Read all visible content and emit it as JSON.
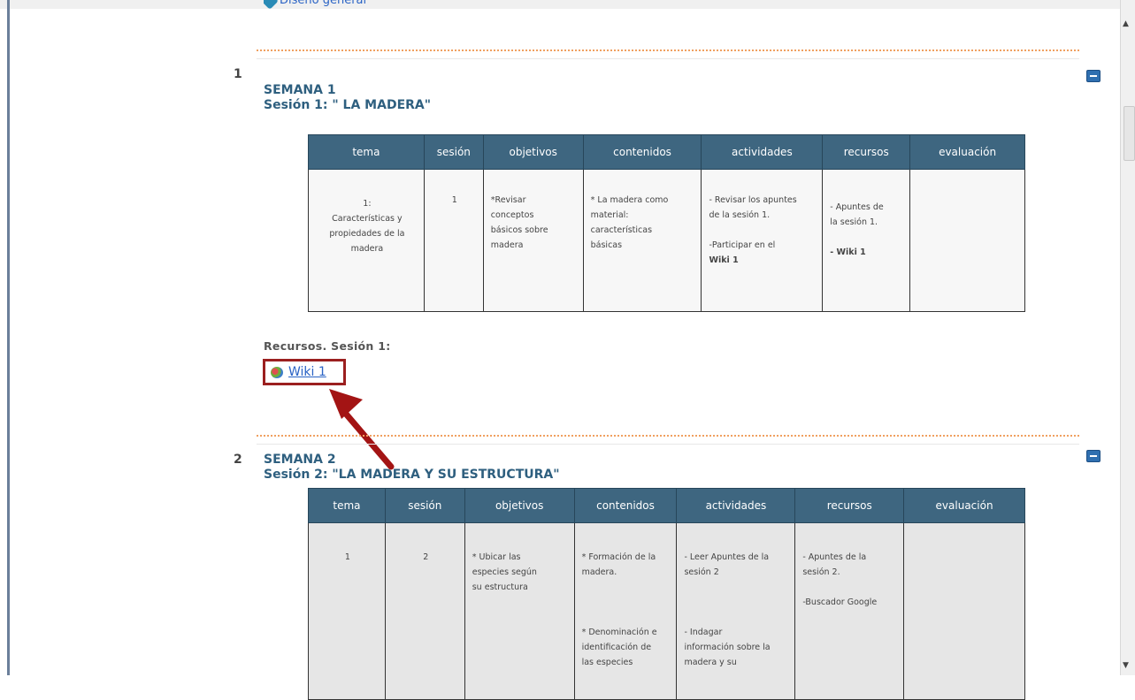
{
  "prev_link": {
    "label": "Diseño general"
  },
  "sections": [
    {
      "number": "1",
      "week": "SEMANA 1",
      "session": "Sesión 1: \" LA MADERA\"",
      "table_headers": [
        "tema",
        "sesión",
        "objetivos",
        "contenidos",
        "actividades",
        "recursos",
        "evaluación"
      ],
      "row": {
        "tema": [
          "1:",
          "Características y",
          "propiedades de la",
          "madera"
        ],
        "sesion": "1",
        "objetivos": [
          "*Revisar",
          "conceptos",
          "básicos sobre",
          "madera"
        ],
        "contenidos": [
          "* La madera como",
          "material:",
          "características",
          "básicas"
        ],
        "actividades_1": [
          "- Revisar los apuntes",
          "de la sesión 1."
        ],
        "actividades_2": "-Participar en el",
        "actividades_3": "Wiki 1",
        "recursos_1": [
          "- Apuntes de",
          "la sesión 1."
        ],
        "recursos_2": "- Wiki 1",
        "evaluacion": ""
      },
      "resources_title": "Recursos. Sesión 1:",
      "resource_link": "Wiki 1"
    },
    {
      "number": "2",
      "week": "SEMANA 2",
      "session": "Sesión 2: \"LA MADERA Y SU ESTRUCTURA\"",
      "table_headers": [
        "tema",
        "sesión",
        "objetivos",
        "contenidos",
        "actividades",
        "recursos",
        "evaluación"
      ],
      "row": {
        "tema": "1",
        "sesion": "2",
        "objetivos": [
          "* Ubicar las",
          "especies según",
          "su estructura"
        ],
        "contenidos_1": [
          "* Formación de la",
          "madera."
        ],
        "contenidos_2": [
          "* Denominación e",
          "identificación de",
          "las especies"
        ],
        "actividades_1": [
          "- Leer Apuntes de la",
          "sesión 2"
        ],
        "actividades_2": [
          "- Indagar",
          "información sobre la",
          "madera y su"
        ],
        "recursos_1": [
          "- Apuntes de la",
          "sesión 2."
        ],
        "recursos_2": "-Buscador Google",
        "evaluacion": ""
      }
    }
  ],
  "colors": {
    "header_bg": "#3e6680",
    "link": "#2a4ec8",
    "highlight": "#9b1f1f",
    "divider": "#f0a060"
  }
}
